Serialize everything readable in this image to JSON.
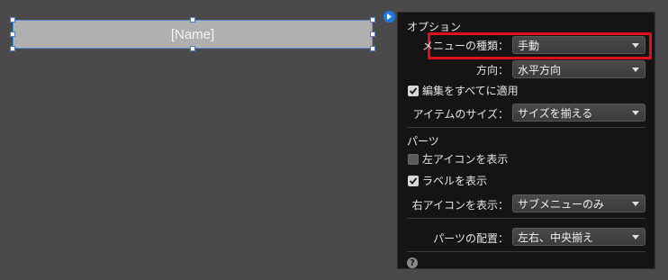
{
  "canvas": {
    "element_label": "[Name]"
  },
  "panel": {
    "options_title": "オプション",
    "menu_type": {
      "label": "メニューの種類：",
      "value": "手動"
    },
    "direction": {
      "label": "方向：",
      "value": "水平方向"
    },
    "apply_edits": {
      "label": "編集をすべてに適用",
      "checked": true
    },
    "item_size": {
      "label": "アイテムのサイズ：",
      "value": "サイズを揃える"
    },
    "parts_title": "パーツ",
    "show_left_icon": {
      "label": "左アイコンを表示",
      "checked": false
    },
    "show_label": {
      "label": "ラベルを表示",
      "checked": true
    },
    "right_icon": {
      "label": "右アイコンを表示：",
      "value": "サブメニューのみ"
    },
    "parts_layout": {
      "label": "パーツの配置：",
      "value": "左右、中央揃え"
    },
    "help_glyph": "?"
  },
  "icons": {
    "inspector_toggle": "play-arrow-icon",
    "checkmark": "checkmark-icon",
    "help": "help-icon"
  },
  "colors": {
    "highlight": "#e0101a",
    "toggle_button": "#1e7be6"
  }
}
